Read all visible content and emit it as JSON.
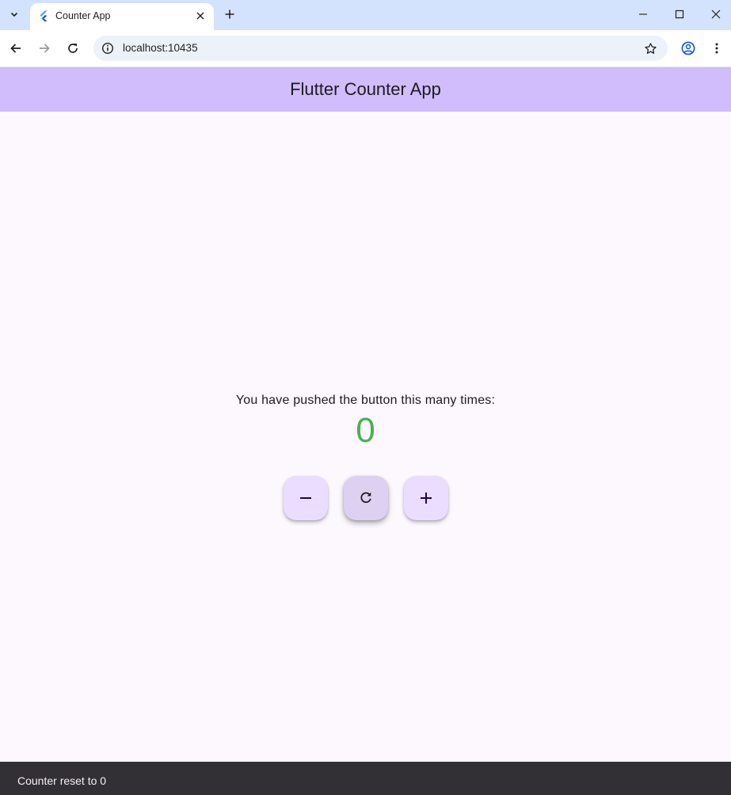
{
  "browser": {
    "tab_title": "Counter App",
    "url": "localhost:10435"
  },
  "icons": {
    "favicon": "flutter-logo-icon",
    "tab_search": "chevron-down-icon",
    "tab_close": "close-icon",
    "new_tab": "plus-icon",
    "minimize": "minimize-icon",
    "maximize": "maximize-icon",
    "close_window": "close-icon",
    "back": "arrow-left-icon",
    "forward": "arrow-right-icon",
    "reload": "reload-icon",
    "site_info": "info-icon",
    "bookmark": "star-icon",
    "profile": "account-circle-icon",
    "menu": "more-vert-icon",
    "decrement": "minus-icon",
    "reset": "refresh-icon",
    "increment": "plus-icon"
  },
  "app": {
    "title": "Flutter Counter App",
    "counter_label": "You have pushed the button this many times:",
    "counter_value": "0"
  },
  "snackbar": {
    "message": "Counter reset to 0"
  },
  "colors": {
    "app_bar": "#d1bcfc",
    "background": "#fdf7fe",
    "counter_value": "#4caf50",
    "fab": "#eaddff",
    "snackbar": "#322f35",
    "tab_strip": "#d3e3fd"
  }
}
